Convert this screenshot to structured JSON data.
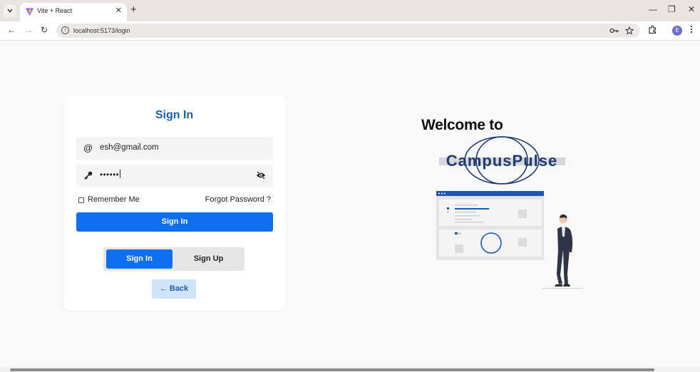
{
  "browser": {
    "tab_title": "Vite + React",
    "tab_close": "✕",
    "new_tab": "+",
    "url": "localhost:5173/login",
    "avatar_letter": "E",
    "nav": {
      "back": "←",
      "forward": "→",
      "reload": "↻"
    },
    "window": {
      "minimize": "—",
      "restore": "❐",
      "close": "✕"
    }
  },
  "login": {
    "title": "Sign In",
    "email_icon": "@",
    "email_value": "esh@gmail.com",
    "password_value": "••••••",
    "remember_label": "Remember Me",
    "forgot_label": "Forgot Password ?",
    "submit_label": "Sign In",
    "toggle": {
      "signin": "Sign In",
      "signup": "Sign Up",
      "active": "signin"
    },
    "back_label": "← Back"
  },
  "welcome": {
    "heading": "Welcome to",
    "logo_text": "CampusPulse"
  },
  "colors": {
    "primary": "#0d6ef0",
    "title_blue": "#1a5fa8",
    "logo_navy": "#1f3c70",
    "back_bg": "#cfe3fb"
  },
  "icons": [
    "chevron-down-icon",
    "vite-favicon-icon",
    "info-icon",
    "key-icon",
    "star-icon",
    "puzzle-icon",
    "kebab-icon",
    "at-icon",
    "key-icon",
    "eye-off-icon",
    "arrow-left-icon"
  ]
}
